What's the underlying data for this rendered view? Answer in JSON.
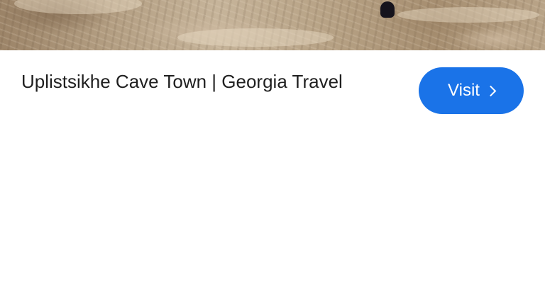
{
  "result_card": {
    "title": "Uplistsikhe Cave Town | Georgia Travel",
    "visit_button_label": "Visit",
    "visit_button_icon": "chevron-right-icon",
    "accent_color": "#1a73e8"
  }
}
